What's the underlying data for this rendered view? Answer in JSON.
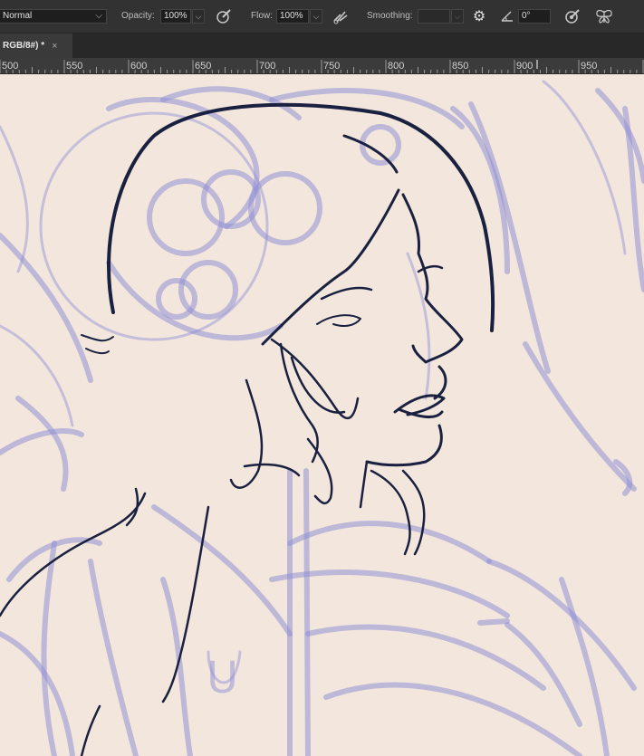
{
  "options_bar": {
    "blend_mode": "Normal",
    "opacity_label": "Opacity:",
    "opacity_value": "100%",
    "flow_label": "Flow:",
    "flow_value": "100%",
    "smoothing_label": "Smoothing:",
    "smoothing_value": "",
    "angle_value": "0°",
    "icons": [
      "chevron-down-icon",
      "pressure-opacity-icon",
      "airbrush-icon",
      "gear-icon",
      "angle-icon",
      "pressure-size-icon",
      "symmetry-butterfly-icon"
    ]
  },
  "document_tab": {
    "title": "RGB/8#) *",
    "close_glyph": "×"
  },
  "ruler": {
    "ticks": [
      "500",
      "550",
      "600",
      "650",
      "700",
      "750",
      "800",
      "850",
      "900",
      "950"
    ]
  },
  "canvas": {
    "background_color": "#f3e6dc",
    "ink_color": "#1a2140",
    "sketch_color": "#8f8fd6",
    "stray_letter": "U"
  },
  "colors": {
    "panel": "#323232",
    "tab_bar": "#282828",
    "ruler": "#3b3b3b"
  }
}
